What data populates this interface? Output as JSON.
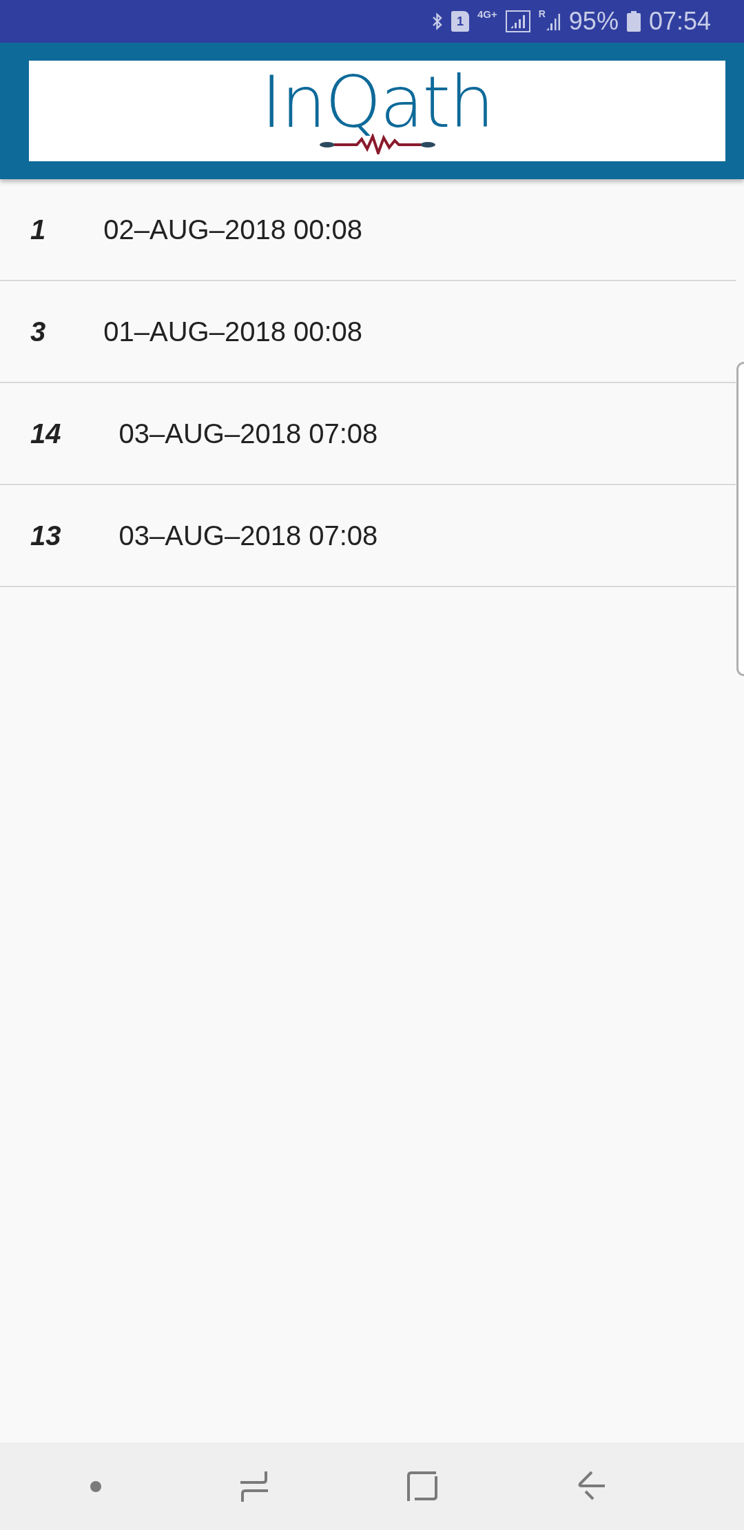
{
  "status_bar": {
    "sim_number": "1",
    "network_type": "4G+",
    "roaming": "R",
    "battery": "95%",
    "time": "07:54"
  },
  "header": {
    "logo_text": "InQath"
  },
  "rows": [
    {
      "number": "1",
      "date": "02–AUG–2018 00:08"
    },
    {
      "number": "3",
      "date": "01–AUG–2018 00:08"
    },
    {
      "number": "14",
      "date": "03–AUG–2018 07:08"
    },
    {
      "number": "13",
      "date": "03–AUG–2018 07:08"
    }
  ]
}
